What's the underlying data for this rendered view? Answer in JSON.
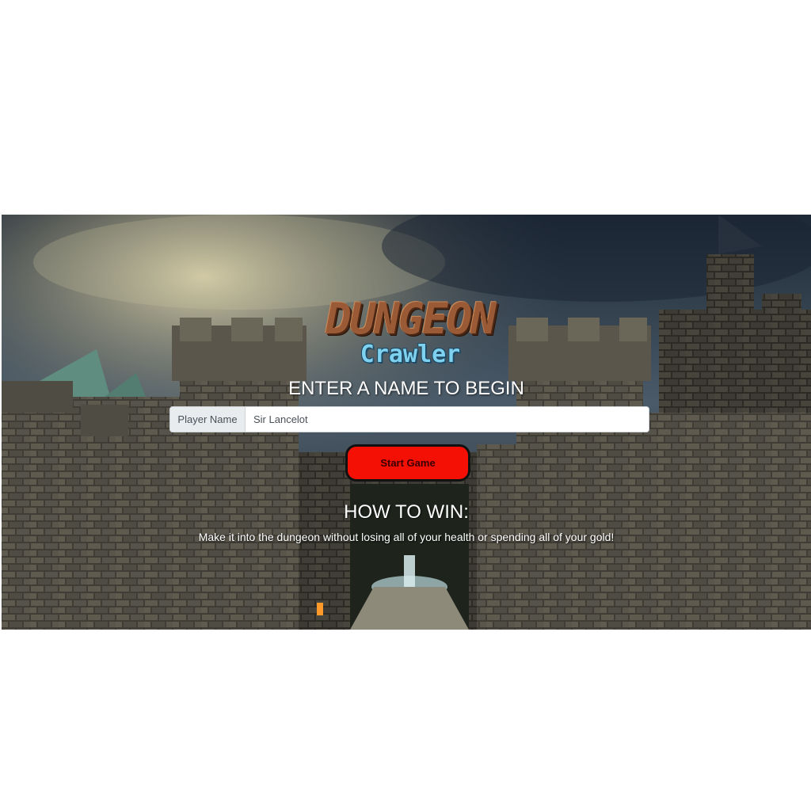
{
  "logo": {
    "title": "DUNGEON",
    "subtitle": "Crawler"
  },
  "prompt": "ENTER A NAME TO BEGIN",
  "player_input": {
    "label": "Player Name",
    "value": "Sir Lancelot"
  },
  "start_button": {
    "label": "Start Game",
    "color": "#f41005"
  },
  "how_to_win": {
    "title": "HOW TO WIN:",
    "text": "Make it into the dungeon without losing all of your health or spending all of your gold!"
  },
  "colors": {
    "logo_brown": "#9a5a36",
    "logo_blue": "#7fd2ef",
    "sky": "#2a3340"
  }
}
